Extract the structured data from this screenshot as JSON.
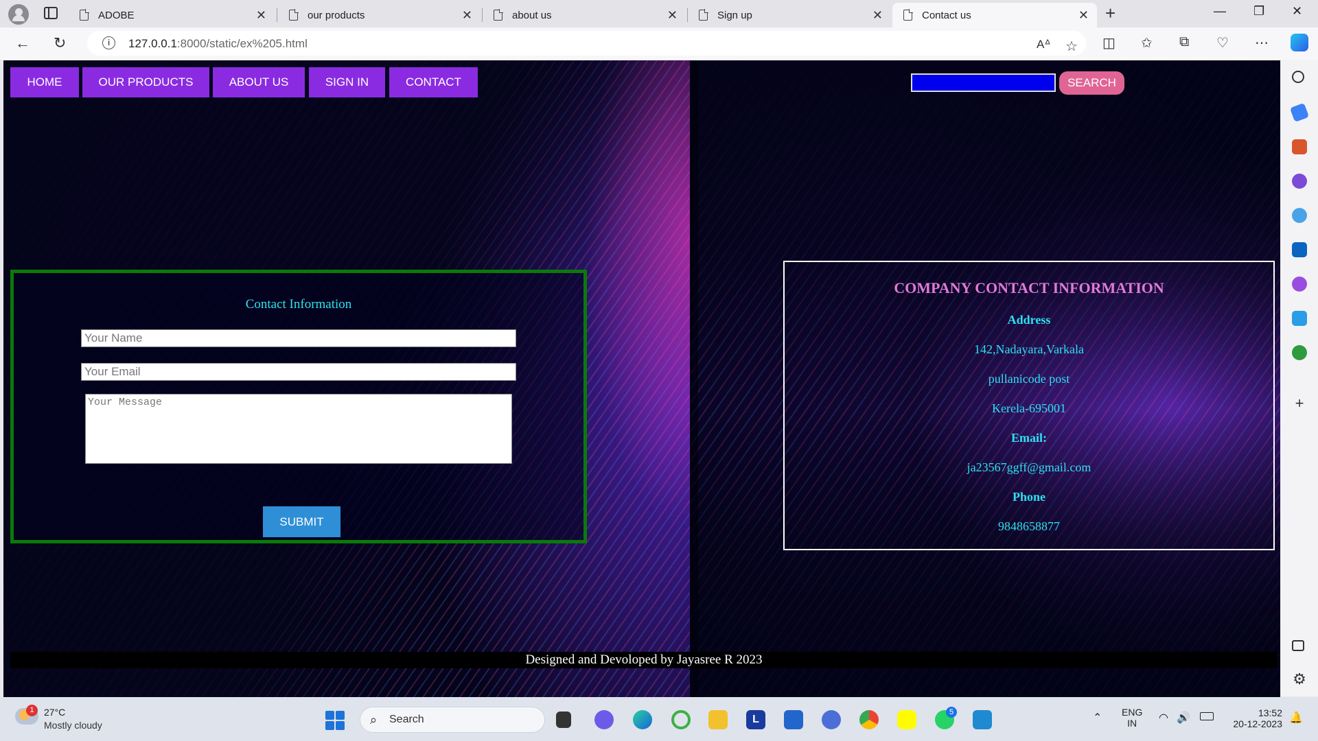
{
  "browser": {
    "tabs": [
      {
        "title": "ADOBE"
      },
      {
        "title": "our products"
      },
      {
        "title": "about us"
      },
      {
        "title": "Sign up"
      },
      {
        "title": "Contact us"
      }
    ],
    "url_host": "127.0.0.1",
    "url_rest": ":8000/static/ex%205.html"
  },
  "nav": {
    "items": [
      "HOME",
      "OUR PRODUCTS",
      "ABOUT US",
      "SIGN IN",
      "CONTACT"
    ],
    "search_label": "SEARCH"
  },
  "form": {
    "title": "Contact Information",
    "name_placeholder": "Your Name",
    "email_placeholder": "Your Email",
    "message_placeholder": "Your Message",
    "submit_label": "SUBMIT"
  },
  "company": {
    "title": "COMPANY CONTACT INFORMATION",
    "address_label": "Address",
    "address_line1": "142,Nadayara,Varkala",
    "address_line2": "pullanicode post",
    "address_line3": "Kerela-695001",
    "email_label": "Email:",
    "email": "ja23567ggff@gmail.com",
    "phone_label": "Phone",
    "phone": "9848658877"
  },
  "footer": {
    "text": "Designed and Devoloped by Jayasree R 2023"
  },
  "taskbar": {
    "weather_temp": "27°C",
    "weather_desc": "Mostly cloudy",
    "weather_badge": "1",
    "search_label": "Search",
    "whatsapp_badge": "5",
    "lang": "ENG",
    "region": "IN",
    "time": "13:52",
    "date": "20-12-2023"
  },
  "colors": {
    "nav_bg": "#8a2be2",
    "search_btn": "#e06595",
    "form_border": "#0a7a0a",
    "cyan_text": "#2ee0f0",
    "title_pink": "#e07ad8",
    "submit_bg": "#2e8fd6"
  }
}
